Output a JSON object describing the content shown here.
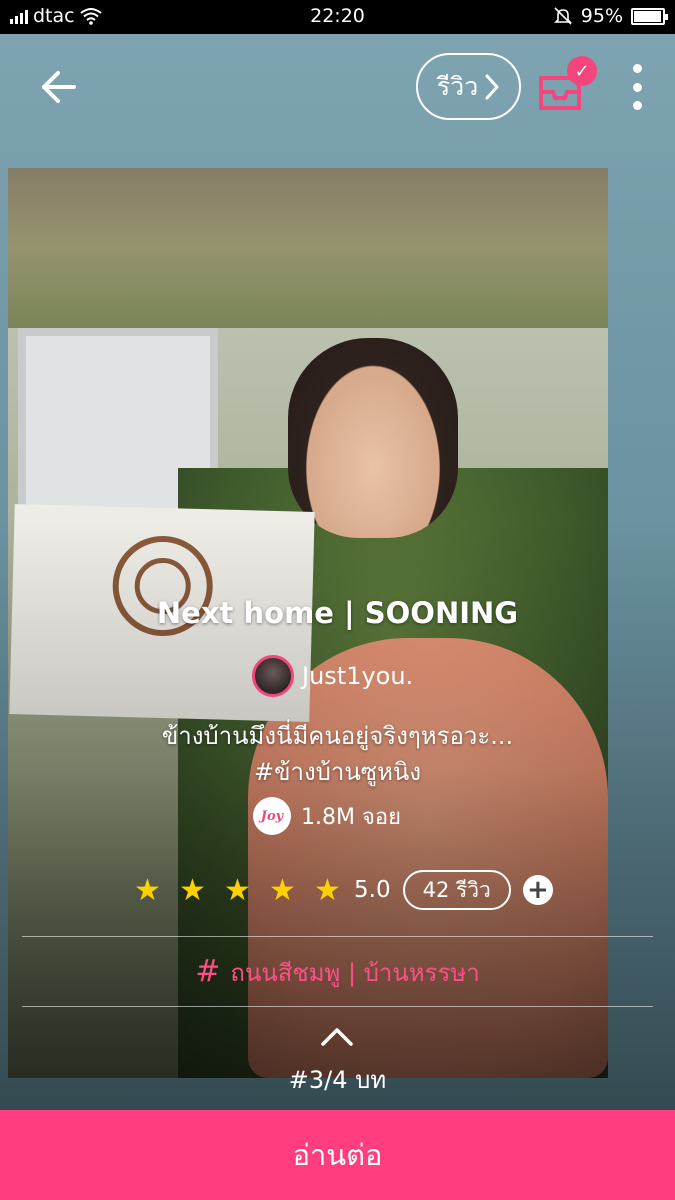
{
  "status_bar": {
    "carrier": "dtac",
    "time": "22:20",
    "battery": "95%"
  },
  "header": {
    "review_label": "รีวิว",
    "inbox_badge": "✓"
  },
  "story": {
    "title": "Next home | SOONING",
    "author": "Just1you.",
    "description": "ข้างบ้านมึงนี่มีคนอยู่จริงๆหรอวะ...",
    "hashtag": "#ข้างบ้านซูหนิง",
    "joy_label": "Joy",
    "joy_count": "1.8M จอย",
    "rating": "5.0",
    "stars": 5,
    "reviews_label": "42 รีวิว",
    "tags": "ถนนสีชมพู | บ้านหรรษา",
    "chapter": "#3/4 บท"
  },
  "footer": {
    "read_label": "อ่านต่อ"
  },
  "colors": {
    "accent": "#ff3d7f",
    "tag": "#ff4e87",
    "star": "#ffd000"
  }
}
